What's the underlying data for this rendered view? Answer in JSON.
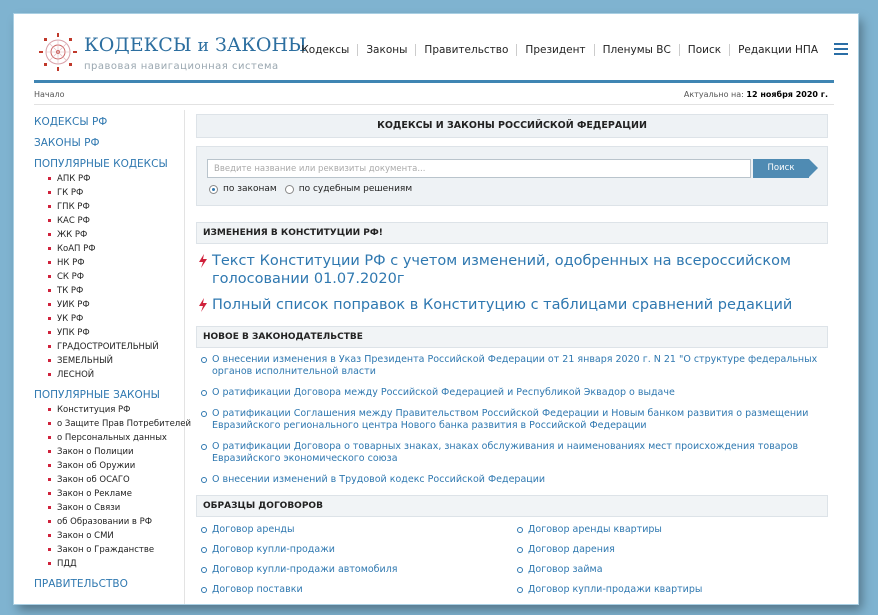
{
  "header": {
    "brand_main": "КОДЕКСЫ",
    "brand_and": "и",
    "brand_end": "ЗАКОНЫ",
    "tagline": "правовая навигационная система",
    "nav": [
      "Кодексы",
      "Законы",
      "Правительство",
      "Президент",
      "Пленумы ВС",
      "Поиск",
      "Редакции НПА"
    ]
  },
  "subbar": {
    "breadcrumb": "Начало",
    "actual_label": "Актуально на:",
    "actual_date": "12 ноября 2020 г."
  },
  "sidebar": {
    "codes_rf": "КОДЕКСЫ РФ",
    "laws_rf": "ЗАКОНЫ РФ",
    "popular_codes": "ПОПУЛЯРНЫЕ КОДЕКСЫ",
    "codes": [
      "АПК РФ",
      "ГК РФ",
      "ГПК РФ",
      "КАС РФ",
      "ЖК РФ",
      "КоАП РФ",
      "НК РФ",
      "СК РФ",
      "ТК РФ",
      "УИК РФ",
      "УК РФ",
      "УПК РФ",
      "ГРАДОСТРОИТЕЛЬНЫЙ",
      "ЗЕМЕЛЬНЫЙ",
      "ЛЕСНОЙ"
    ],
    "popular_laws": "ПОПУЛЯРНЫЕ ЗАКОНЫ",
    "laws": [
      "Конституция РФ",
      "о Защите Прав Потребителей",
      "о Персональных данных",
      "Закон о Полиции",
      "Закон об Оружии",
      "Закон об ОСАГО",
      "Закон о Рекламе",
      "Закон о Связи",
      "об Образовании в РФ",
      "Закон о СМИ",
      "Закон о Гражданстве",
      "ПДД"
    ],
    "government": "ПРАВИТЕЛЬСТВО"
  },
  "main": {
    "title": "КОДЕКСЫ И ЗАКОНЫ РОССИЙСКОЙ ФЕДЕРАЦИИ",
    "search": {
      "placeholder": "Введите название или реквизиты документа...",
      "button": "Поиск",
      "radio_laws": "по законам",
      "radio_courts": "по судебным решениям"
    },
    "constitution_header": "ИЗМЕНЕНИЯ В КОНСТИТУЦИИ РФ!",
    "constitution_links": [
      "Текст Конституции РФ с учетом изменений, одобренных на всероссийском голосовании 01.07.2020г",
      "Полный список поправок в Конституцию с таблицами сравнений редакций"
    ],
    "news_header": "НОВОЕ В ЗАКОНОДАТЕЛЬСТВЕ",
    "news": [
      "О внесении изменения в Указ Президента Российской Федерации от 21 января 2020 г. N 21 \"О структуре федеральных органов исполнительной власти",
      "О ратификации Договора между Российской Федерацией и Республикой Эквадор о выдаче",
      "О ратификации Соглашения между Правительством Российской Федерации и Новым банком развития о размещении Евразийского регионального центра Нового банка развития в Российской Федерации",
      "О ратификации Договора о товарных знаках, знаках обслуживания и наименованиях мест происхождения товаров Евразийского экономического союза",
      "О внесении изменений в Трудовой кодекс Российской Федерации"
    ],
    "contracts_header": "ОБРАЗЦЫ ДОГОВОРОВ",
    "contracts_left": [
      "Договор аренды",
      "Договор купли-продажи",
      "Договор купли-продажи автомобиля",
      "Договор поставки"
    ],
    "contracts_right": [
      "Договор аренды квартиры",
      "Договор дарения",
      "Договор займа",
      "Договор купли-продажи квартиры"
    ]
  },
  "colors": {
    "accent": "#2f78b0",
    "bullet": "#d0213b",
    "frame_bg": "#7fb3d0"
  }
}
